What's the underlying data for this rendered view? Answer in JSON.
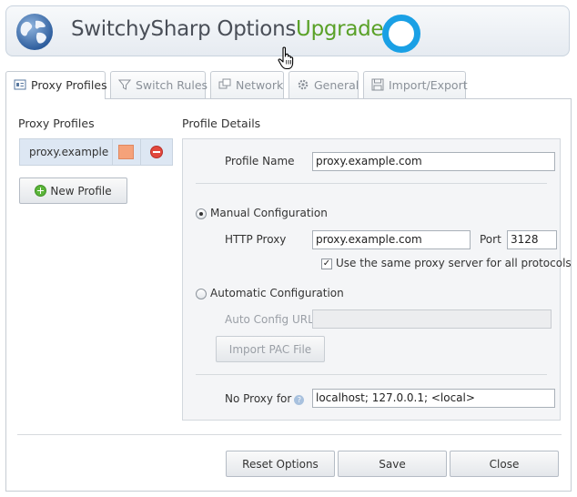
{
  "header": {
    "title": "SwitchySharp Options",
    "upgrade_label": "Upgrade",
    "logo_icon": "globe-icon",
    "status_icon": "ring-icon",
    "accent_color": "#5aa128",
    "ring_color": "#1aa0e5"
  },
  "tabs": [
    {
      "label": "Proxy Profiles",
      "icon": "profile-icon",
      "active": true
    },
    {
      "label": "Switch Rules",
      "icon": "filter-icon",
      "active": false
    },
    {
      "label": "Network",
      "icon": "network-icon",
      "active": false
    },
    {
      "label": "General",
      "icon": "gear-icon",
      "active": false
    },
    {
      "label": "Import/Export",
      "icon": "floppy-icon",
      "active": false
    }
  ],
  "profiles": {
    "heading": "Proxy Profiles",
    "items": [
      {
        "name": "proxy.example.com",
        "color": "#f5a27a"
      }
    ],
    "new_button": "New Profile"
  },
  "details": {
    "heading": "Profile Details",
    "profile_name_label": "Profile Name",
    "profile_name_value": "proxy.example.com",
    "manual_label": "Manual Configuration",
    "manual_selected": true,
    "http_proxy_label": "HTTP Proxy",
    "http_proxy_value": "proxy.example.com",
    "port_label": "Port",
    "port_value": "3128",
    "same_proxy_label": "Use the same proxy server for all protocols",
    "same_proxy_checked": true,
    "auto_label": "Automatic Configuration",
    "auto_url_label": "Auto Config URL",
    "auto_url_value": "",
    "import_pac_button": "Import PAC File",
    "no_proxy_label": "No Proxy for",
    "no_proxy_value": "localhost; 127.0.0.1; <local>"
  },
  "footer": {
    "reset_button": "Reset Options",
    "save_button": "Save",
    "close_button": "Close"
  }
}
